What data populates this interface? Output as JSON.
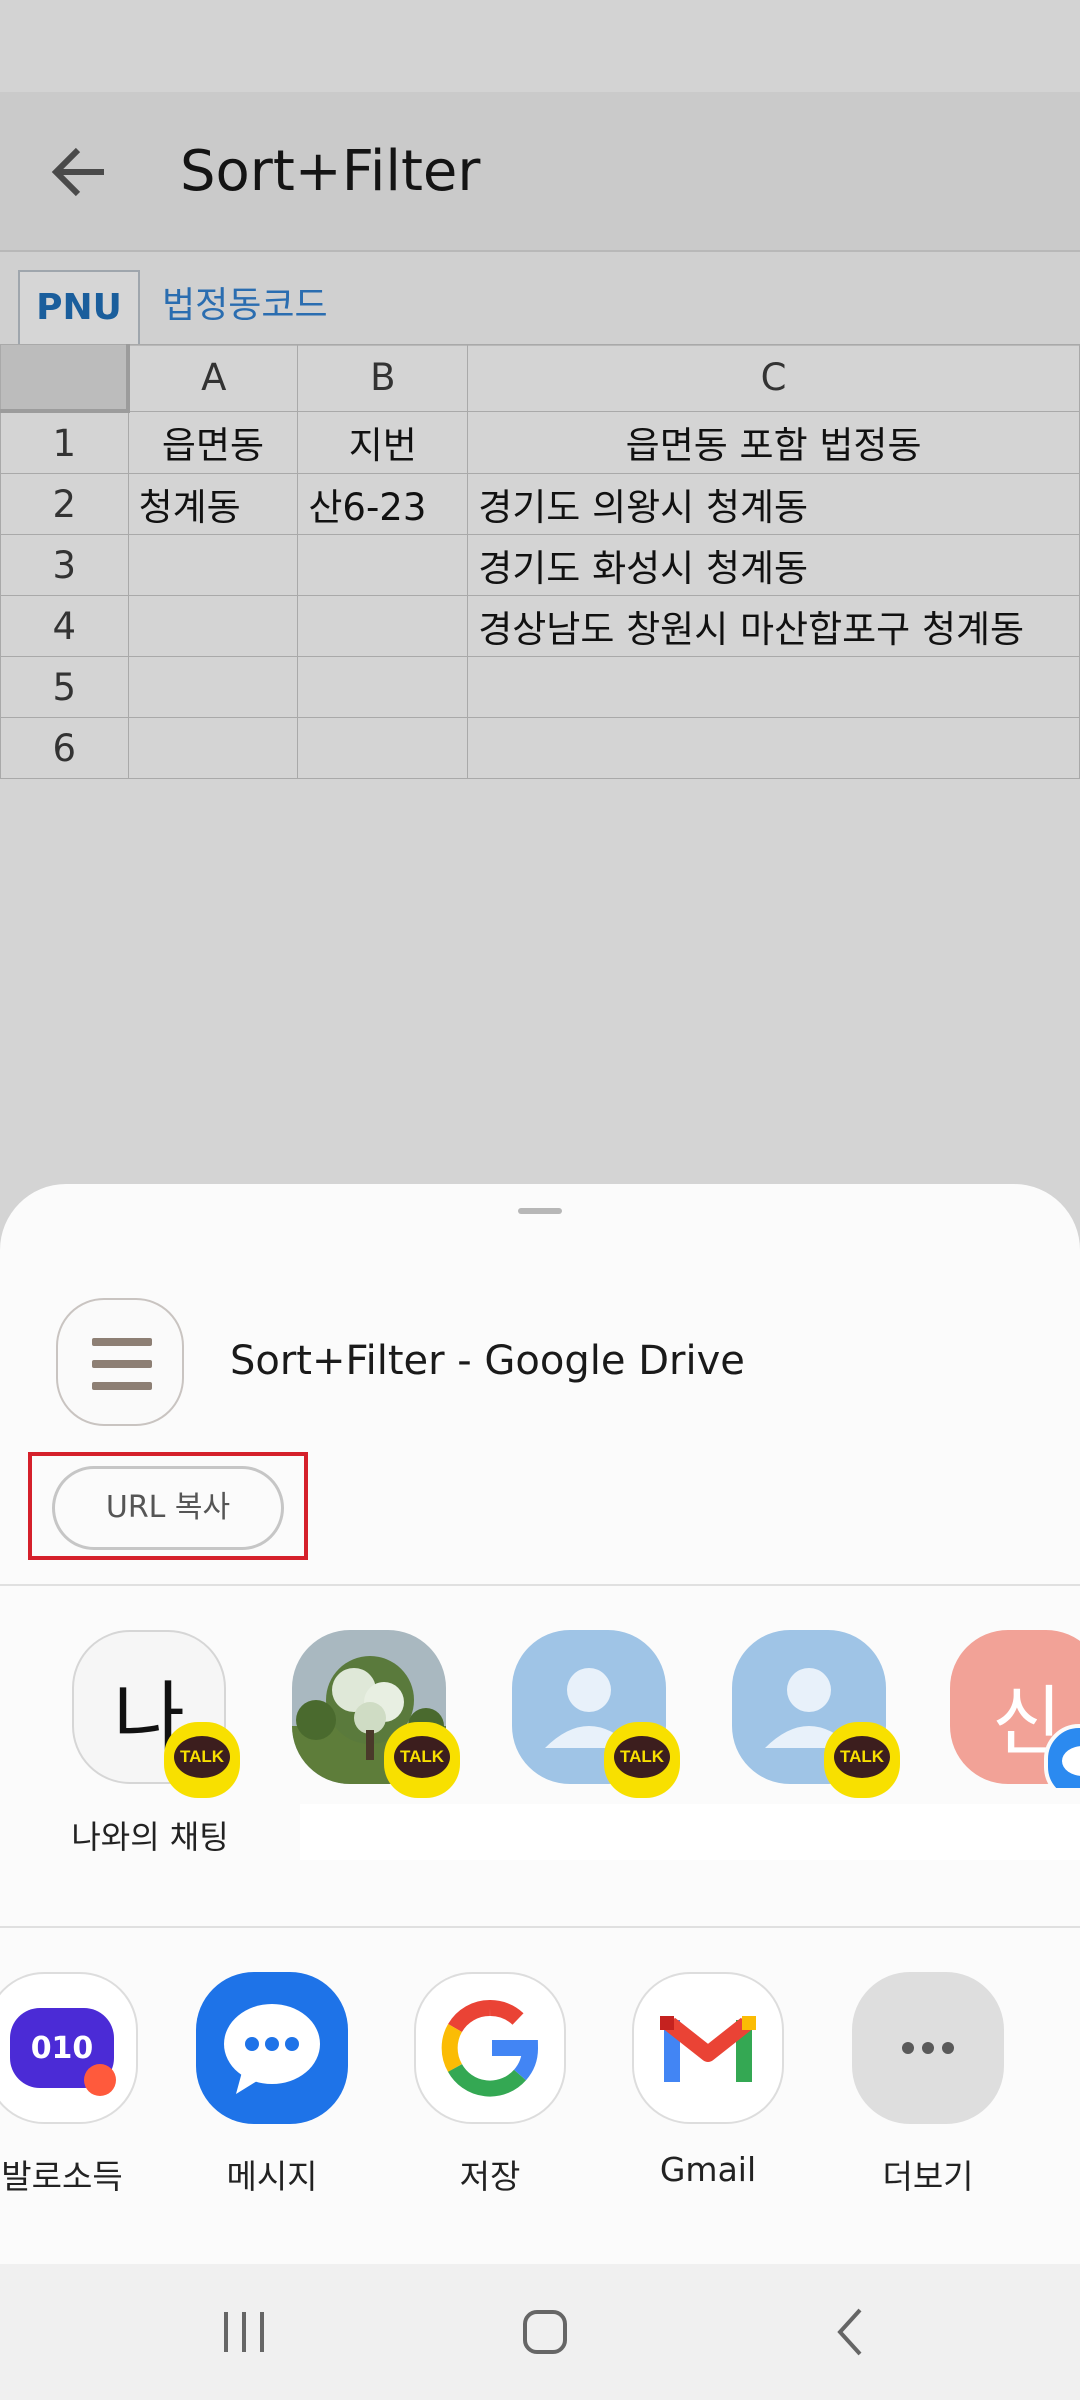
{
  "app_bar": {
    "title": "Sort+Filter"
  },
  "sheet_tabs": [
    "PNU",
    "법정동코드"
  ],
  "grid": {
    "columns": [
      "A",
      "B",
      "C"
    ],
    "rows": [
      {
        "num": "1",
        "cells": [
          "읍면동",
          "지번",
          "읍면동 포함 법정동"
        ]
      },
      {
        "num": "2",
        "cells": [
          "청계동",
          "산6-23",
          "경기도 의왕시 청계동"
        ]
      },
      {
        "num": "3",
        "cells": [
          "",
          "",
          "경기도 화성시 청계동"
        ]
      },
      {
        "num": "4",
        "cells": [
          "",
          "",
          "경상남도 창원시 마산합포구 청계동"
        ]
      },
      {
        "num": "5",
        "cells": [
          "",
          "",
          ""
        ]
      },
      {
        "num": "6",
        "cells": [
          "",
          "",
          ""
        ]
      }
    ]
  },
  "share_sheet": {
    "doc_title": "Sort+Filter - Google Drive",
    "url_copy_label": "URL 복사",
    "contacts": [
      {
        "label": "나와의 채팅",
        "icon_text": "나",
        "icon": "kakao-my-chat-icon"
      },
      {
        "label": "",
        "icon": "contact-photo-tree"
      },
      {
        "label": "",
        "icon": "default-person-icon"
      },
      {
        "label": "",
        "icon": "default-person-icon"
      },
      {
        "label": "",
        "icon_text": "신",
        "icon": "contact-initial-icon"
      }
    ],
    "talk_badge": "TALK",
    "apps": [
      {
        "label": "발로소득",
        "icon": "balo-app-icon"
      },
      {
        "label": "메시지",
        "icon": "messages-icon"
      },
      {
        "label": "저장",
        "icon": "google-icon"
      },
      {
        "label": "Gmail",
        "icon": "gmail-icon"
      },
      {
        "label": "더보기",
        "icon": "more-icon"
      }
    ]
  },
  "colors": {
    "highlight": "#d5202b",
    "talk_yellow": "#f8e000",
    "messages_blue": "#1e73e8",
    "contact_blue": "#9fc4e6",
    "contact_pink": "#f2a297"
  }
}
